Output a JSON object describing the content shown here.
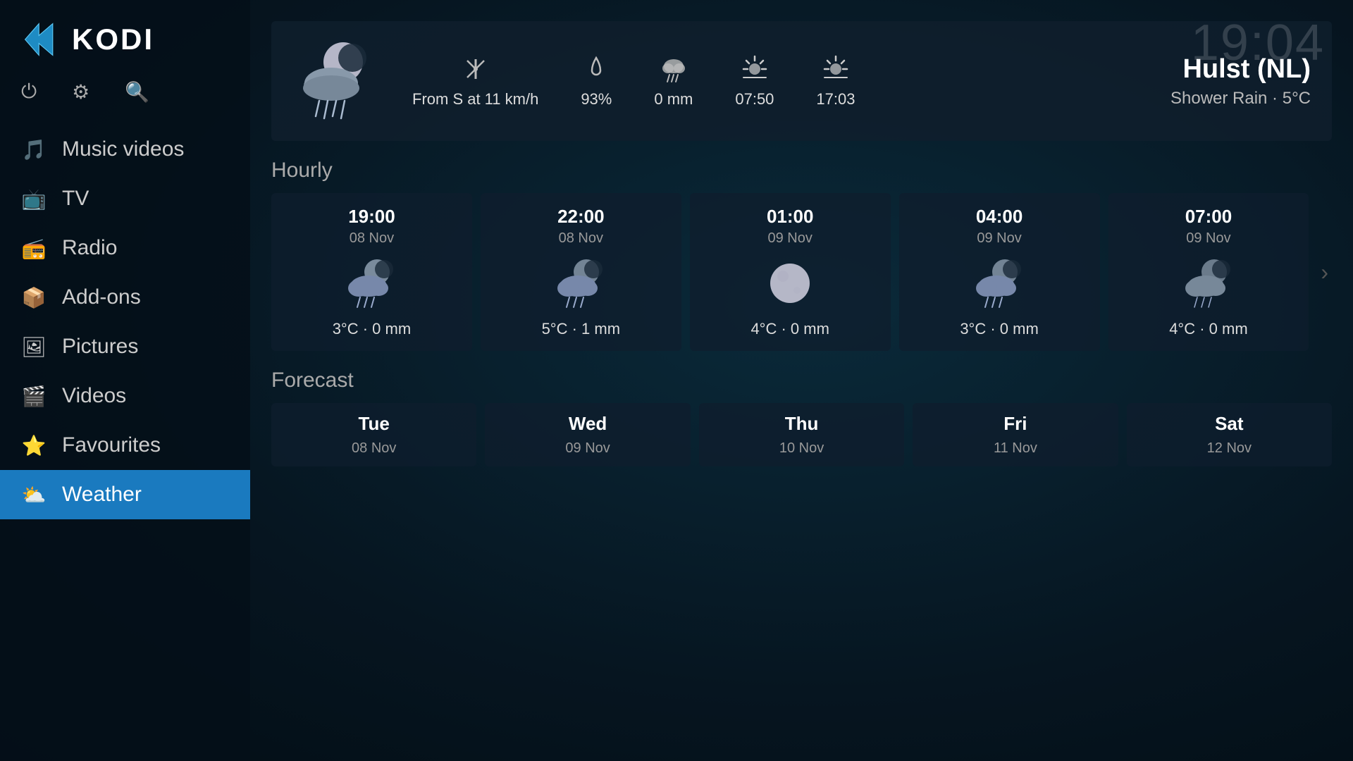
{
  "clock": "19:04",
  "sidebar": {
    "app_name": "KODI",
    "nav_items": [
      {
        "id": "music-videos",
        "label": "Music videos",
        "icon": "🎵"
      },
      {
        "id": "tv",
        "label": "TV",
        "icon": "📺"
      },
      {
        "id": "radio",
        "label": "Radio",
        "icon": "📻"
      },
      {
        "id": "add-ons",
        "label": "Add-ons",
        "icon": "📦"
      },
      {
        "id": "pictures",
        "label": "Pictures",
        "icon": "🖼"
      },
      {
        "id": "videos",
        "label": "Videos",
        "icon": "🎬"
      },
      {
        "id": "favourites",
        "label": "Favourites",
        "icon": "⭐"
      },
      {
        "id": "weather",
        "label": "Weather",
        "icon": "⛅",
        "active": true
      }
    ]
  },
  "weather": {
    "location": "Hulst (NL)",
    "condition": "Shower Rain · 5°C",
    "wind": "From S at 11 km/h",
    "humidity": "93%",
    "precipitation": "0 mm",
    "sunrise": "07:50",
    "sunset": "17:03",
    "hourly_label": "Hourly",
    "forecast_label": "Forecast",
    "hourly": [
      {
        "time": "19:00",
        "date": "08 Nov",
        "temp": "3°C · 0 mm"
      },
      {
        "time": "22:00",
        "date": "08 Nov",
        "temp": "5°C · 1 mm"
      },
      {
        "time": "01:00",
        "date": "09 Nov",
        "temp": "4°C · 0 mm"
      },
      {
        "time": "04:00",
        "date": "09 Nov",
        "temp": "3°C · 0 mm"
      },
      {
        "time": "07:00",
        "date": "09 Nov",
        "temp": "4°C · 0 mm"
      }
    ],
    "forecast": [
      {
        "day": "Tue",
        "date": "08 Nov"
      },
      {
        "day": "Wed",
        "date": "09 Nov"
      },
      {
        "day": "Thu",
        "date": "10 Nov"
      },
      {
        "day": "Fri",
        "date": "11 Nov"
      },
      {
        "day": "Sat",
        "date": "12 Nov"
      }
    ]
  }
}
